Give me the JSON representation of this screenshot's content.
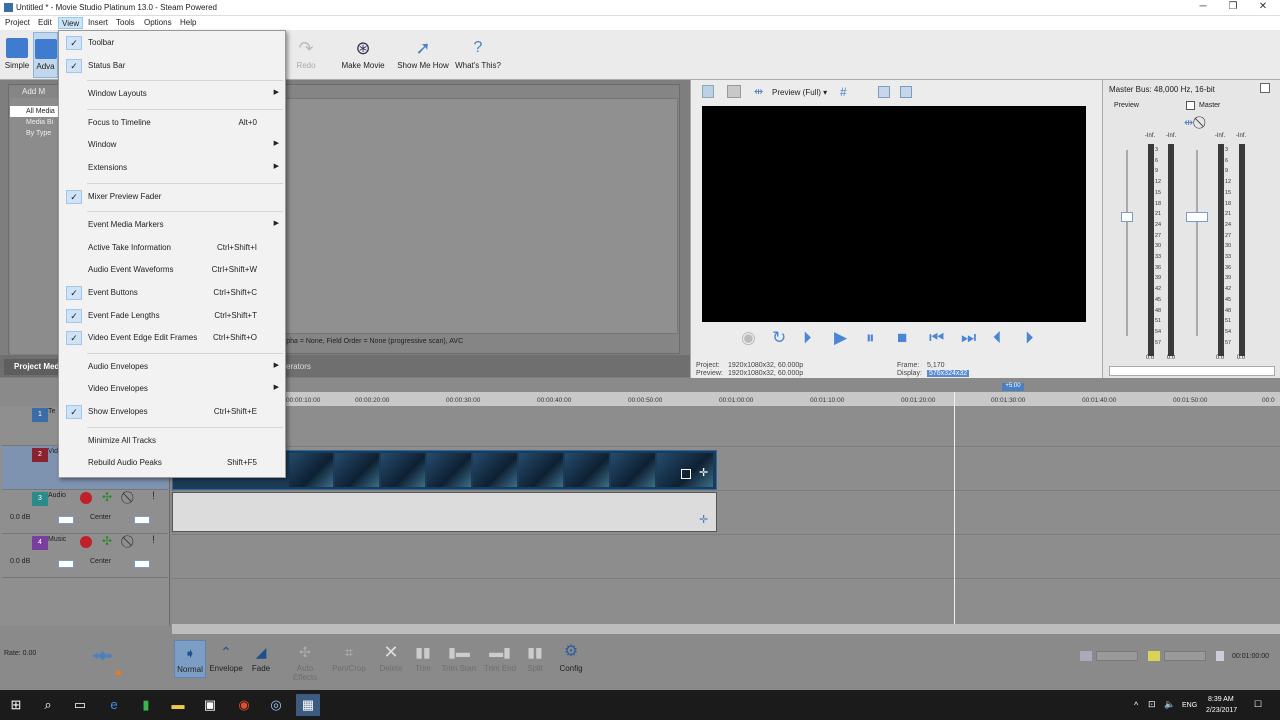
{
  "window": {
    "title": "Untitled * - Movie Studio Platinum 13.0 - Steam Powered",
    "controls": [
      "─",
      "❐",
      "✕"
    ]
  },
  "menubar": [
    "Project",
    "Edit",
    "View",
    "Insert",
    "Tools",
    "Options",
    "Help"
  ],
  "toolbar": {
    "simple": "Simple",
    "advanced": "Adva",
    "redo": "Redo",
    "make_movie": "Make Movie",
    "show_me_how": "Show Me How",
    "whats_this": "What's This?"
  },
  "explorer": {
    "add_media": "Add M",
    "tree": [
      "All Media",
      "Media Bi",
      "By Type"
    ],
    "info": "Alpha = None, Field Order = None (progressive scan), AVC",
    "tabs": [
      "Project Med",
      "erators"
    ]
  },
  "preview": {
    "mode": "Preview (Full)",
    "project_label": "Project:",
    "project_val": "1920x1080x32, 60.000p",
    "preview_label": "Preview:",
    "preview_val": "1920x1080x32, 60.000p",
    "frame_label": "Frame:",
    "frame_val": "5,170",
    "display_label": "Display:",
    "display_val": "576x324x32"
  },
  "mixer": {
    "title": "Master Bus: 48,000 Hz, 16-bit",
    "preview": "Preview",
    "master": "Master",
    "inf": "-Inf.",
    "scale": [
      "3",
      "6",
      "9",
      "12",
      "15",
      "18",
      "21",
      "24",
      "27",
      "30",
      "33",
      "36",
      "39",
      "42",
      "45",
      "48",
      "51",
      "54",
      "57"
    ],
    "zero": "0.0"
  },
  "ruler": {
    "cursor": "+5:00",
    "times": [
      "00:00:10:00",
      "00:00:20:00",
      "00:00:30:00",
      "00:00:40:00",
      "00:00:50:00",
      "00:01:00:00",
      "00:01:10:00",
      "00:01:20:00",
      "00:01:30:00",
      "00:01:40:00",
      "00:01:50:00",
      "00:0"
    ]
  },
  "tracks": [
    {
      "num": "1",
      "name": "Te",
      "color": "#3b6ca8"
    },
    {
      "num": "2",
      "name": "Vid",
      "color": "#8a2230"
    },
    {
      "num": "3",
      "name": "Audio",
      "vol": "0.0 dB",
      "pan": "Center",
      "color": "#2b8a8a"
    },
    {
      "num": "4",
      "name": "Music",
      "vol": "0.0 dB",
      "pan": "Center",
      "color": "#7a3e9e"
    }
  ],
  "bottom": {
    "rate": "Rate: 0.00",
    "tools": [
      "Normal",
      "Envelope",
      "Fade",
      "Auto Effects",
      "Pan/Crop",
      "Delete",
      "Trim",
      "Trim Start",
      "Trim End",
      "Split",
      "Config"
    ],
    "time": "00:01:00:00"
  },
  "taskbar": {
    "lang": "ENG",
    "time": "8:39 AM",
    "date": "2/23/2017"
  },
  "viewmenu": [
    {
      "label": "Toolbar",
      "checked": true
    },
    {
      "label": "Status Bar",
      "checked": true
    },
    {
      "sep": true
    },
    {
      "label": "Window Layouts",
      "submenu": true
    },
    {
      "sep": true
    },
    {
      "label": "Focus to Timeline",
      "shortcut": "Alt+0"
    },
    {
      "label": "Window",
      "submenu": true
    },
    {
      "label": "Extensions",
      "submenu": true
    },
    {
      "sep": true
    },
    {
      "label": "Mixer Preview Fader",
      "checked": true
    },
    {
      "sep": true
    },
    {
      "label": "Event Media Markers",
      "submenu": true
    },
    {
      "label": "Active Take Information",
      "shortcut": "Ctrl+Shift+I"
    },
    {
      "label": "Audio Event Waveforms",
      "shortcut": "Ctrl+Shift+W"
    },
    {
      "label": "Event Buttons",
      "shortcut": "Ctrl+Shift+C",
      "checked": true
    },
    {
      "label": "Event Fade Lengths",
      "shortcut": "Ctrl+Shift+T",
      "checked": true
    },
    {
      "label": "Video Event Edge Edit Frames",
      "shortcut": "Ctrl+Shift+O",
      "checked": true
    },
    {
      "sep": true
    },
    {
      "label": "Audio Envelopes",
      "submenu": true
    },
    {
      "label": "Video Envelopes",
      "submenu": true
    },
    {
      "label": "Show Envelopes",
      "shortcut": "Ctrl+Shift+E",
      "checked": true
    },
    {
      "sep": true
    },
    {
      "label": "Minimize All Tracks"
    },
    {
      "label": "Rebuild Audio Peaks",
      "shortcut": "Shift+F5"
    }
  ]
}
